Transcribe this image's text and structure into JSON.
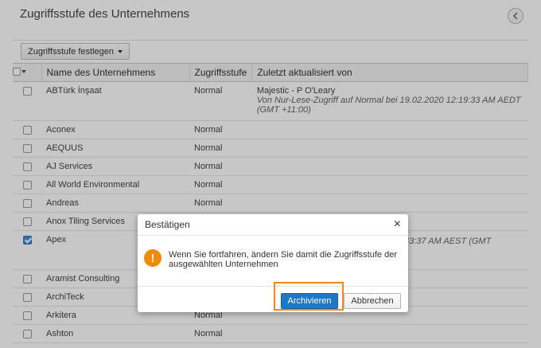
{
  "header": {
    "title": "Zugriffsstufe des Unternehmens"
  },
  "toolbar": {
    "set_level_label": "Zugriffsstufe festlegen"
  },
  "table": {
    "columns": [
      "Name des Unternehmens",
      "Zugriffsstufe",
      "Zuletzt aktualisiert von"
    ],
    "rows": [
      {
        "name": "ABTürk İnşaat",
        "level": "Normal",
        "updated_by": "Majestic - P O'Leary",
        "note": "Von Nur-Lese-Zugriff auf Normal bei 19.02.2020 12:19:33 AM AEDT (GMT +11:00)",
        "checked": false
      },
      {
        "name": "Aconex",
        "level": "Normal",
        "updated_by": "",
        "note": "",
        "checked": false
      },
      {
        "name": "AEQUUS",
        "level": "Normal",
        "updated_by": "",
        "note": "",
        "checked": false
      },
      {
        "name": "AJ Services",
        "level": "Normal",
        "updated_by": "",
        "note": "",
        "checked": false
      },
      {
        "name": "All World Environmental",
        "level": "Normal",
        "updated_by": "",
        "note": "",
        "checked": false
      },
      {
        "name": "Andreas",
        "level": "Normal",
        "updated_by": "",
        "note": "",
        "checked": false
      },
      {
        "name": "Anox Tiling Services",
        "level": "",
        "updated_by": "",
        "note": "",
        "checked": false
      },
      {
        "name": "Apex",
        "level": "",
        "updated_by": "",
        "note": "10:43:37 AM AEST (GMT",
        "checked": true
      },
      {
        "name": "Aramist Consulting",
        "level": "",
        "updated_by": "",
        "note": "",
        "checked": false
      },
      {
        "name": "ArchiTeck",
        "level": "",
        "updated_by": "",
        "note": "",
        "checked": false
      },
      {
        "name": "Arkitera",
        "level": "Normal",
        "updated_by": "",
        "note": "",
        "checked": false
      },
      {
        "name": "Ashton",
        "level": "Normal",
        "updated_by": "",
        "note": "",
        "checked": false
      }
    ]
  },
  "dialog": {
    "title": "Bestätigen",
    "close": "×",
    "message": "Wenn Sie fortfahren, ändern Sie damit die Zugriffsstufe der ausgewählten Unternehmen",
    "confirm_label": "Archivieren",
    "cancel_label": "Abbrechen"
  },
  "colors": {
    "primary": "#1f77c8",
    "warning": "#f28a00",
    "highlight": "#f28a1a"
  },
  "icons": {
    "collapse": "chevron-left-icon",
    "warning": "exclamation-icon",
    "close": "close-icon"
  }
}
